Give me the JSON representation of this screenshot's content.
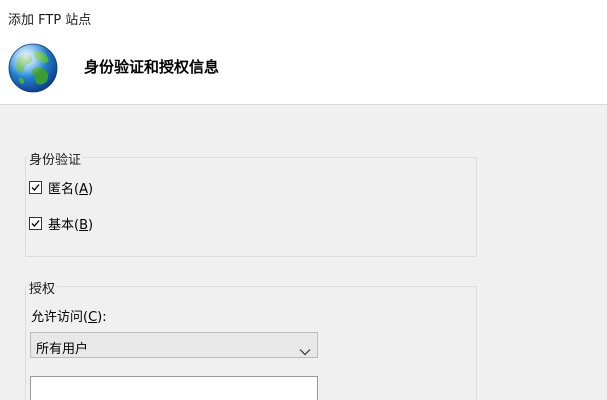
{
  "window": {
    "title": "添加 FTP 站点"
  },
  "header": {
    "title": "身份验证和授权信息",
    "icon": "globe-icon"
  },
  "authentication": {
    "legend": "身份验证",
    "anonymous": {
      "label_main": "匿名(",
      "mnemonic": "A",
      "label_tail": ")",
      "checked": true
    },
    "basic": {
      "label_main": "基本(",
      "mnemonic": "B",
      "label_tail": ")",
      "checked": true
    }
  },
  "authorization": {
    "legend": "授权",
    "allow_access_label_main": "允许访问(",
    "allow_access_mnemonic": "C",
    "allow_access_label_tail": "):",
    "selected_option": "所有用户",
    "text_value": ""
  },
  "colors": {
    "background": "#f0f0f0",
    "header_background": "#ffffff",
    "dropdown_background": "#e8e8e8"
  }
}
